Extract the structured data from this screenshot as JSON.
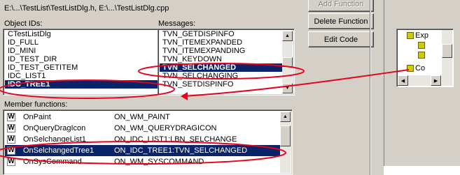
{
  "header": {
    "file_path": "E:\\...\\TestList\\TestListDlg.h, E:\\...\\TestListDlg.cpp"
  },
  "object_ids": {
    "label": "Object IDs:",
    "items": [
      "CTestListDlg",
      "ID_FULL",
      "ID_MINI",
      "ID_TEST_DIR",
      "ID_TEST_GETITEM",
      "IDC_LIST1",
      "IDC_TREE1"
    ],
    "selected": "IDC_TREE1"
  },
  "messages": {
    "label": "Messages:",
    "items": [
      "TVN_GETDISPINFO",
      "TVN_ITEMEXPANDED",
      "TVN_ITEMEXPANDING",
      "TVN_KEYDOWN",
      "TVN_SELCHANGED",
      "TVN_SELCHANGING",
      "TVN_SETDISPINFO"
    ],
    "selected": "TVN_SELCHANGED"
  },
  "member_functions": {
    "label": "Member functions:",
    "rows": [
      {
        "icon": "W",
        "name": "OnPaint",
        "handler": "ON_WM_PAINT"
      },
      {
        "icon": "W",
        "name": "OnQueryDragIcon",
        "handler": "ON_WM_QUERYDRAGICON"
      },
      {
        "icon": "W",
        "name": "OnSelchangeList1",
        "handler": "ON_IDC_LIST1:LBN_SELCHANGE"
      },
      {
        "icon": "W",
        "name": "OnSelchangedTree1",
        "handler": "ON_IDC_TREE1:TVN_SELCHANGED"
      },
      {
        "icon": "W",
        "name": "OnSysCommand",
        "handler": "ON_WM_SYSCOMMAND"
      }
    ],
    "selected_index": 3
  },
  "buttons": {
    "add_function": "Add Function",
    "delete_function": "Delete Function",
    "edit_code": "Edit Code"
  },
  "tree_preview": {
    "items": [
      "Exp",
      "",
      "",
      "Co"
    ]
  },
  "colors": {
    "selection": "#0a246a",
    "annotation": "#e8001c",
    "dialog_bg": "#d4d0c8"
  }
}
